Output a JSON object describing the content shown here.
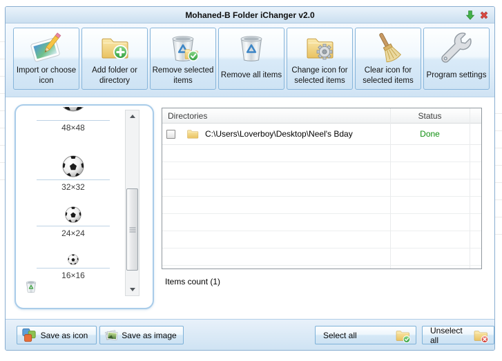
{
  "titlebar": {
    "title": "Mohaned-B Folder iChanger v2.0"
  },
  "toolbar": {
    "buttons": [
      {
        "label": "Import or choose icon",
        "icon": "picture-pencil-icon"
      },
      {
        "label": "Add folder or directory",
        "icon": "folder-plus-icon"
      },
      {
        "label": "Remove selected items",
        "icon": "recycle-bin-check-icon"
      },
      {
        "label": "Remove all items",
        "icon": "recycle-bin-icon"
      },
      {
        "label": "Change icon for selected items",
        "icon": "folder-gear-icon"
      },
      {
        "label": "Clear icon for selected items",
        "icon": "broom-icon"
      },
      {
        "label": "Program settings",
        "icon": "wrench-icon"
      }
    ]
  },
  "preview_panel": {
    "icon": "soccer-ball",
    "size_labels": [
      "48×48",
      "32×32",
      "24×24",
      "16×16"
    ]
  },
  "table": {
    "columns": {
      "directories": "Directories",
      "status": "Status"
    },
    "rows": [
      {
        "directory": "C:\\Users\\Loverboy\\Desktop\\Neel's Bday",
        "status": "Done",
        "checked": false
      }
    ]
  },
  "items_count": "Items count (1)",
  "footer": {
    "save_as_icon": "Save as icon",
    "save_as_image": "Save as image",
    "select_all": "Select all",
    "unselect_all": "Unselect all"
  },
  "colors": {
    "status_done": "#0f8f0f",
    "accent_border": "#7db1d8",
    "titlebar_top": "#eaf3fb",
    "titlebar_bottom": "#cbdff0",
    "minimize_arrow": "#43b049",
    "close_x": "#d84941"
  }
}
